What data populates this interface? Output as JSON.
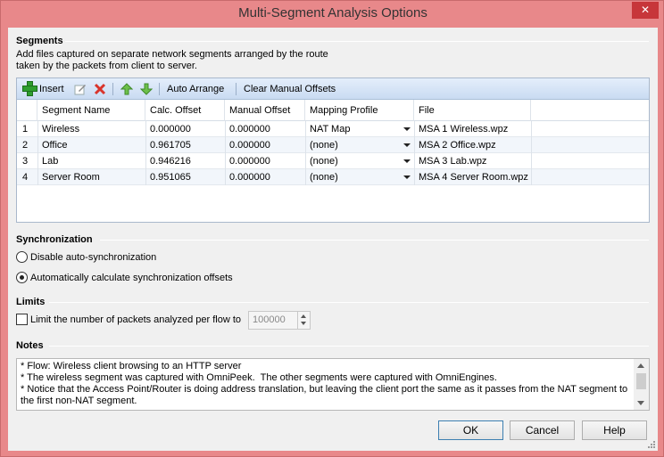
{
  "window": {
    "title": "Multi-Segment Analysis Options",
    "close_label": "✕"
  },
  "segments": {
    "title": "Segments",
    "description": "Add files captured on separate network segments arranged by the route taken by the packets from client to server.",
    "toolbar": {
      "insert_label": "Insert",
      "auto_arrange_label": "Auto Arrange",
      "clear_offsets_label": "Clear Manual Offsets"
    },
    "columns": [
      "Segment Name",
      "Calc. Offset",
      "Manual Offset",
      "Mapping Profile",
      "File"
    ],
    "rows": [
      {
        "num": "1",
        "name": "Wireless",
        "calc": "0.000000",
        "manual": "0.000000",
        "profile": "NAT Map",
        "file": "MSA 1 Wireless.wpz"
      },
      {
        "num": "2",
        "name": "Office",
        "calc": "0.961705",
        "manual": "0.000000",
        "profile": "(none)",
        "file": "MSA 2 Office.wpz"
      },
      {
        "num": "3",
        "name": "Lab",
        "calc": "0.946216",
        "manual": "0.000000",
        "profile": "(none)",
        "file": "MSA 3 Lab.wpz"
      },
      {
        "num": "4",
        "name": "Server Room",
        "calc": "0.951065",
        "manual": "0.000000",
        "profile": "(none)",
        "file": "MSA 4 Server Room.wpz"
      }
    ]
  },
  "sync": {
    "title": "Synchronization",
    "disable_label": "Disable auto-synchronization",
    "auto_label": "Automatically calculate synchronization offsets",
    "selected": "auto"
  },
  "limits": {
    "title": "Limits",
    "limit_label": "Limit the number of packets analyzed per flow to",
    "checked": false,
    "value": "100000"
  },
  "notes": {
    "title": "Notes",
    "text": "* Flow: Wireless client browsing to an HTTP server\n* The wireless segment was captured with OmniPeek.  The other segments were captured with OmniEngines.\n* Notice that the Access Point/Router is doing address translation, but leaving the client port the same as it passes from the NAT segment to the first non-NAT segment."
  },
  "buttons": {
    "ok": "OK",
    "cancel": "Cancel",
    "help": "Help"
  },
  "colors": {
    "titlebar": "#e8888a",
    "close": "#c7363a",
    "toolbar": "#c9dbf2",
    "add": "#2f9e2f",
    "delete": "#d9342b",
    "arrows": "#4caf50"
  },
  "icons": [
    "add-icon",
    "edit-icon",
    "delete-icon",
    "move-up-icon",
    "move-down-icon",
    "dropdown-arrow-icon"
  ]
}
